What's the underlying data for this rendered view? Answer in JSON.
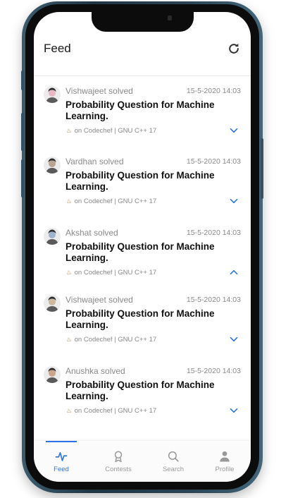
{
  "header": {
    "title": "Feed"
  },
  "feed": [
    {
      "user": "Vishwajeet solved",
      "time": "15-5-2020 14:03",
      "problem": "Probability Question for Machine Learning.",
      "meta": "on  Codechef | GNU C++ 17",
      "expanded": false,
      "avatar_color": "#e9b7c4"
    },
    {
      "user": "Vardhan solved",
      "time": "15-5-2020 14:03",
      "problem": "Probability Question for Machine Learning.",
      "meta": "on  Codechef | GNU C++ 17",
      "expanded": false,
      "avatar_color": "#b9a392"
    },
    {
      "user": "Akshat solved",
      "time": "15-5-2020 14:03",
      "problem": "Probability Question for Machine Learning.",
      "meta": "on  Codechef | GNU C++ 17",
      "expanded": true,
      "avatar_color": "#9fb2d0"
    },
    {
      "user": "Vishwajeet solved",
      "time": "15-5-2020 14:03",
      "problem": "Probability Question for Machine Learning.",
      "meta": "on  Codechef | GNU C++ 17",
      "expanded": false,
      "avatar_color": "#cdb9a0"
    },
    {
      "user": "Anushka solved",
      "time": "15-5-2020 14:03",
      "problem": "Probability Question for Machine Learning.",
      "meta": "on  Codechef | GNU C++ 17",
      "expanded": false,
      "avatar_color": "#c9a58c"
    }
  ],
  "nav": {
    "feed": "Feed",
    "contests": "Contests",
    "search": "Search",
    "profile": "Profile"
  },
  "colors": {
    "accent": "#2d73e8",
    "muted": "#8a8a8a"
  }
}
